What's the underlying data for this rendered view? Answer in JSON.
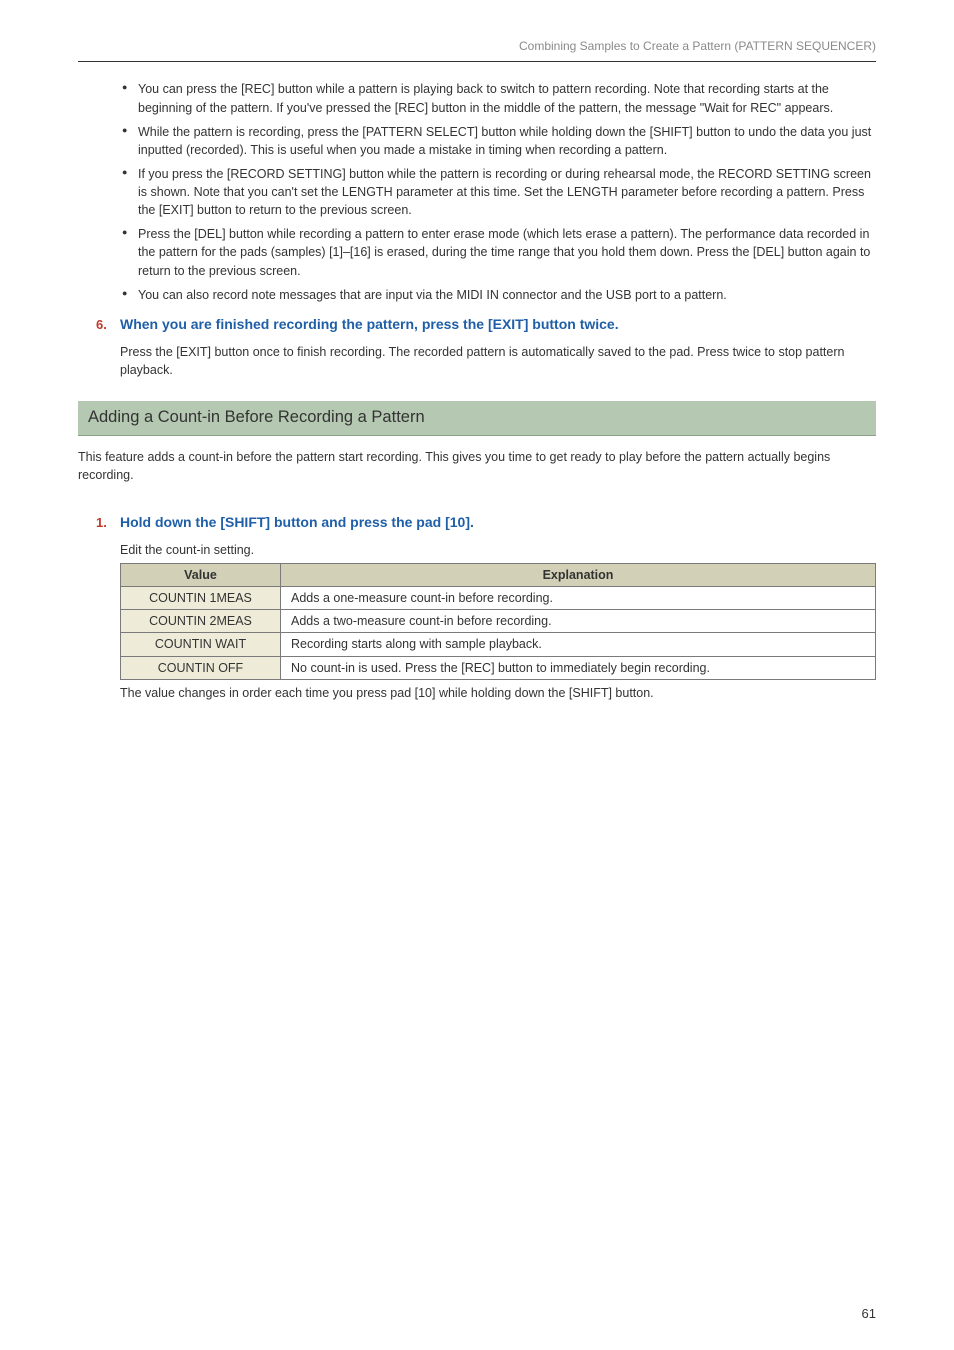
{
  "header": {
    "breadcrumb": "Combining Samples to Create a Pattern (PATTERN SEQUENCER)"
  },
  "bullets": [
    "You can press the [REC] button while a pattern is playing back to switch to pattern recording. Note that recording starts at the beginning of the pattern. If you've pressed the [REC] button in the middle of the pattern, the message \"Wait for REC\" appears.",
    "While the pattern is recording, press the [PATTERN SELECT] button while holding down the [SHIFT] button to undo the data you just inputted (recorded). This is useful when you made a mistake in timing when recording a pattern.",
    "If you press the [RECORD SETTING] button while the pattern is recording or during rehearsal mode, the RECORD SETTING screen is shown. Note that you can't set the LENGTH parameter at this time. Set the LENGTH parameter before recording a pattern. Press the [EXIT] button to return to the previous screen.",
    "Press the [DEL] button while recording a pattern to enter erase mode (which lets erase a pattern). The performance data recorded in the pattern for the pads (samples) [1]–[16] is erased, during the time range that you hold them down. Press the [DEL] button again to return to the previous screen.",
    "You can also record note messages that are input via the MIDI IN connector and the USB port to a pattern."
  ],
  "step6": {
    "num": "6.",
    "title": "When you are finished recording the pattern, press the [EXIT] button twice.",
    "desc": "Press the [EXIT] button once to finish recording. The recorded pattern is automatically saved to the pad. Press twice to stop pattern playback."
  },
  "section": {
    "title": "Adding a Count-in Before Recording a Pattern",
    "intro": "This feature adds a count-in before the pattern start recording. This gives you time to get ready to play before the pattern actually begins recording."
  },
  "step1": {
    "num": "1.",
    "title": "Hold down the [SHIFT] button and press the pad [10].",
    "lead": "Edit the count-in setting."
  },
  "table": {
    "headers": {
      "value": "Value",
      "explanation": "Explanation"
    },
    "rows": [
      {
        "value": "COUNTIN 1MEAS",
        "explanation": "Adds a one-measure count-in before recording."
      },
      {
        "value": "COUNTIN 2MEAS",
        "explanation": "Adds a two-measure count-in before recording."
      },
      {
        "value": "COUNTIN WAIT",
        "explanation": "Recording starts along with sample playback."
      },
      {
        "value": "COUNTIN OFF",
        "explanation": "No count-in is used. Press the [REC] button to immediately begin recording."
      }
    ],
    "tail": "The value changes in order each time you press pad [10] while holding down the [SHIFT] button."
  },
  "pageNumber": "61"
}
